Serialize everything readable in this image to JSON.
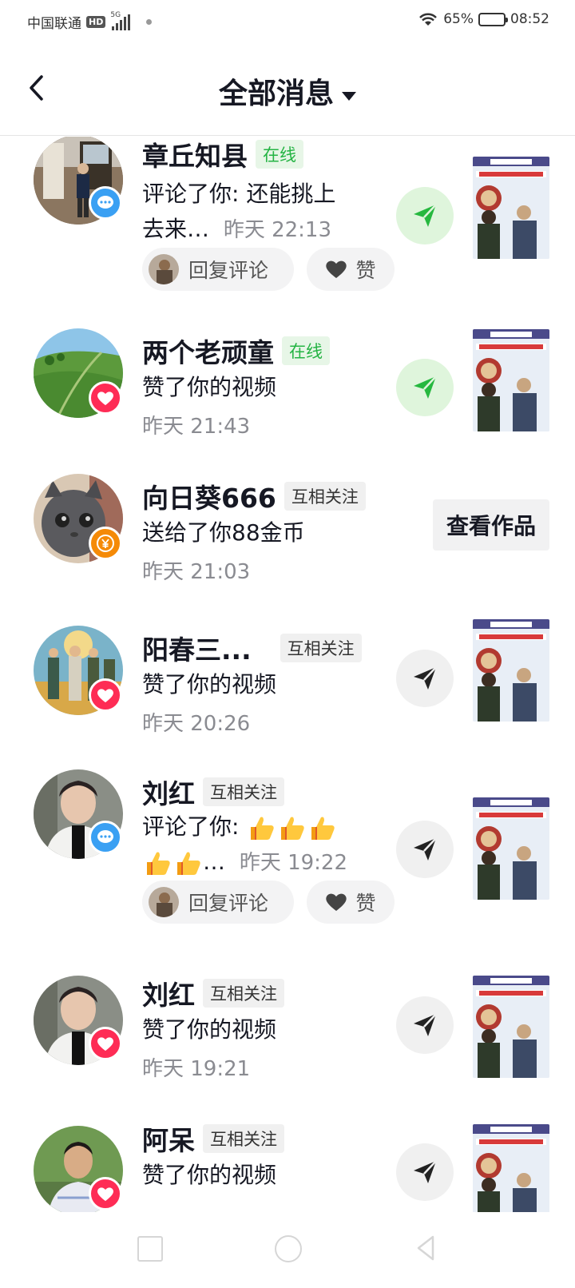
{
  "status_bar": {
    "carrier": "中国联通",
    "hd": "HD",
    "network": "5G",
    "battery": "65%",
    "battery_level": 0.65,
    "time": "08:52"
  },
  "header": {
    "title": "全部消息"
  },
  "messages": [
    {
      "name": "章丘知县",
      "tag": "在线",
      "tag_type": "online",
      "badge": "comment-icon",
      "text_line1": "评论了你: 还能挑上",
      "text_line2": "去来…",
      "time": "昨天 22:13",
      "reply_label": "回复评论",
      "like_label": "赞",
      "send_style": "green"
    },
    {
      "name": "两个老顽童",
      "tag": "在线",
      "tag_type": "online",
      "badge": "heart-icon",
      "text": "赞了你的视频",
      "time": "昨天 21:43",
      "send_style": "green"
    },
    {
      "name": "向日葵666",
      "tag": "互相关注",
      "tag_type": "mutual",
      "badge": "coin-icon",
      "text": "送给了你88金币",
      "time": "昨天 21:03",
      "action_label": "查看作品"
    },
    {
      "name": "阳春三...",
      "tag": "互相关注",
      "tag_type": "mutual",
      "badge": "heart-icon",
      "text": "赞了你的视频",
      "time": "昨天 20:26",
      "send_style": "gray"
    },
    {
      "name": "刘红",
      "tag": "互相关注",
      "tag_type": "mutual",
      "badge": "comment-icon",
      "text_line1": "评论了你: ",
      "text_line2_suffix": "…",
      "time": "昨天 19:22",
      "reply_label": "回复评论",
      "like_label": "赞",
      "send_style": "gray"
    },
    {
      "name": "刘红",
      "tag": "互相关注",
      "tag_type": "mutual",
      "badge": "heart-icon",
      "text": "赞了你的视频",
      "time": "昨天 19:21",
      "send_style": "gray"
    },
    {
      "name": "阿呆",
      "tag": "互相关注",
      "tag_type": "mutual",
      "badge": "heart-icon",
      "text": "赞了你的视频",
      "send_style": "gray"
    }
  ]
}
